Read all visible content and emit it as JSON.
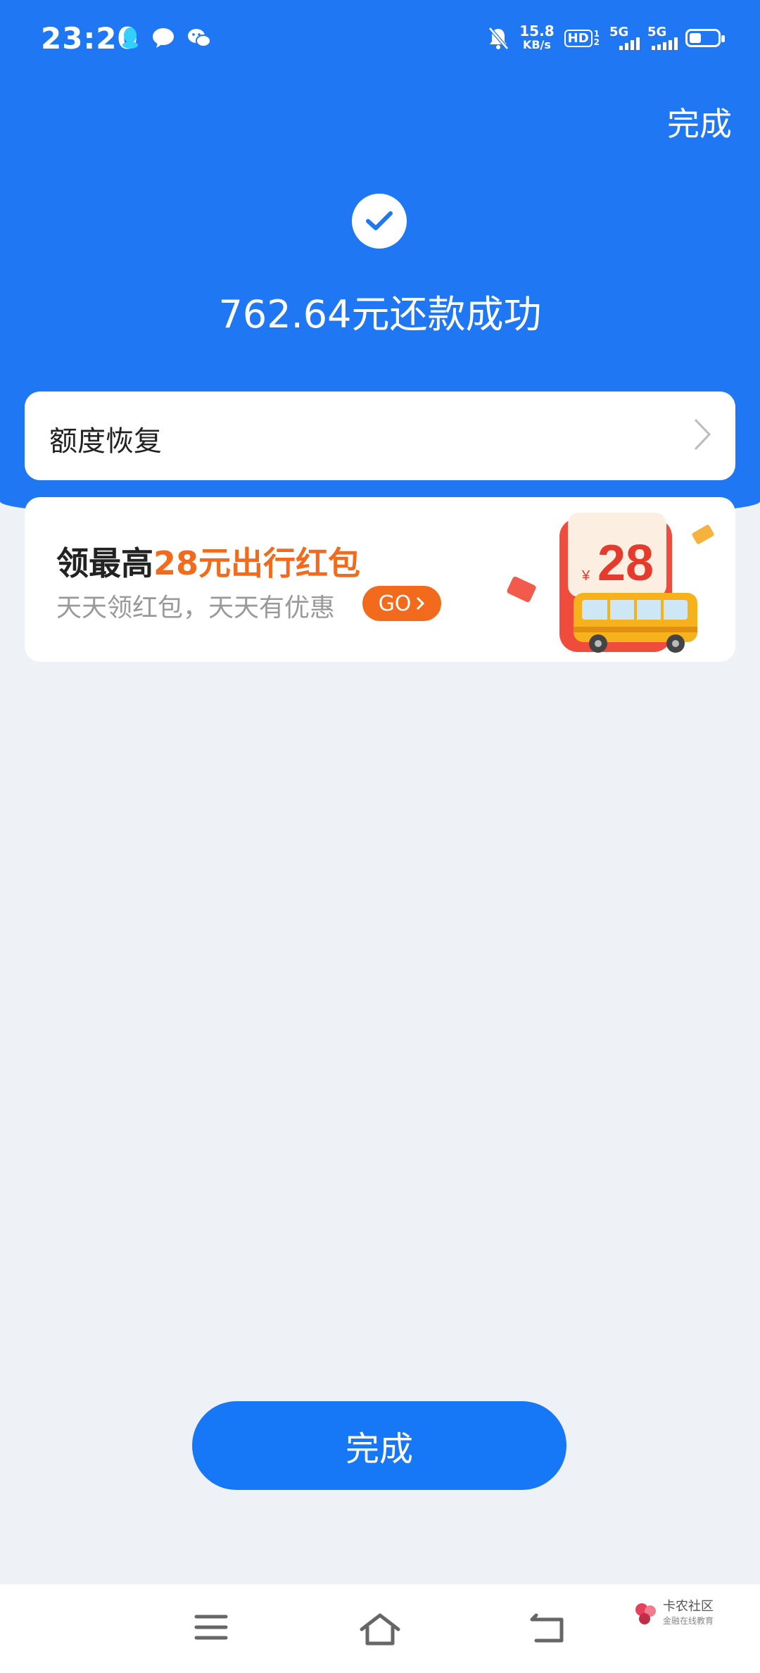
{
  "status_bar": {
    "time": "23:20",
    "net_speed_value": "15.8",
    "net_speed_unit": "KB/s",
    "hd_label": "HD",
    "network1": "5G",
    "network2": "5G",
    "icons": [
      "qq-icon",
      "message-icon",
      "wechat-icon",
      "mute-icon",
      "battery-icon"
    ],
    "battery_level": 0.4
  },
  "header": {
    "done_label": "完成",
    "success_message": "762.64元还款成功",
    "accent_color": "#1f77f3"
  },
  "limit_card": {
    "label": "额度恢复"
  },
  "promo": {
    "title_prefix": "领最高",
    "title_highlight": "28元出行红包",
    "subtitle": "天天领红包，天天有优惠",
    "go_label": "GO",
    "badge_currency": "¥",
    "badge_amount": "28",
    "highlight_color": "#f26b1d"
  },
  "bottom": {
    "done_button_label": "完成"
  },
  "watermark": {
    "name": "卡农社区",
    "tagline": "金融在线教育"
  }
}
